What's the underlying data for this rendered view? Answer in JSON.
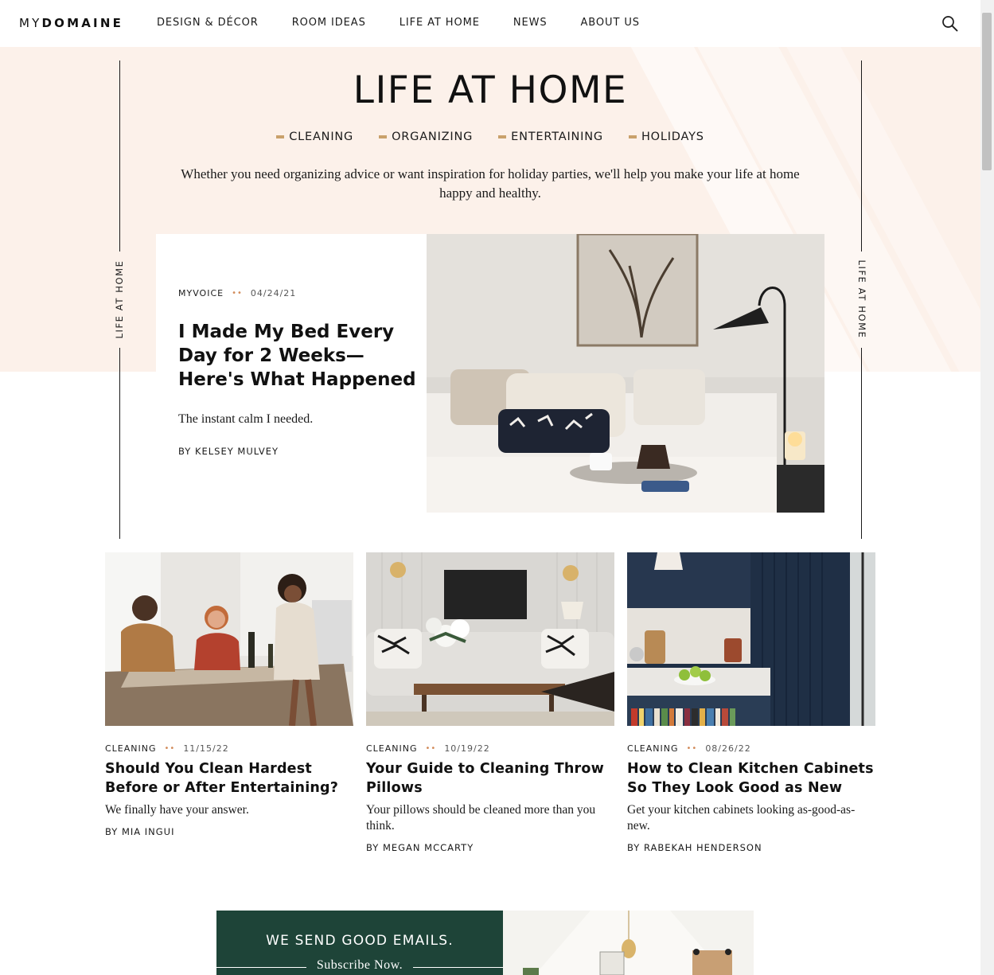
{
  "header": {
    "logo_my": "MY",
    "logo_domaine": "DOMAINE",
    "nav": [
      "DESIGN & DÉCOR",
      "ROOM IDEAS",
      "LIFE AT HOME",
      "NEWS",
      "ABOUT US"
    ]
  },
  "hero": {
    "title": "LIFE AT HOME",
    "side_label": "LIFE AT HOME",
    "subnav": [
      "CLEANING",
      "ORGANIZING",
      "ENTERTAINING",
      "HOLIDAYS"
    ],
    "intro": "Whether you need organizing advice or want inspiration for holiday parties, we'll help you make your life at home happy and healthy."
  },
  "featured": {
    "category": "MYVOICE",
    "dots": "••",
    "date": "04/24/21",
    "title": "I Made My Bed Every Day for 2 Weeks—Here's What Happened",
    "dek": "The instant calm I needed.",
    "byline": "BY KELSEY MULVEY"
  },
  "cards": [
    {
      "category": "CLEANING",
      "dots": "••",
      "date": "11/15/22",
      "title": "Should You Clean Hardest Before or After Entertaining?",
      "dek": "We finally have your answer.",
      "byline": "BY MIA INGUI"
    },
    {
      "category": "CLEANING",
      "dots": "••",
      "date": "10/19/22",
      "title": "Your Guide to Cleaning Throw Pillows",
      "dek": "Your pillows should be cleaned more than you think.",
      "byline": "BY MEGAN MCCARTY"
    },
    {
      "category": "CLEANING",
      "dots": "••",
      "date": "08/26/22",
      "title": "How to Clean Kitchen Cabinets So They Look Good as New",
      "dek": "Get your kitchen cabinets looking as-good-as-new.",
      "byline": "BY RABEKAH HENDERSON"
    }
  ],
  "newsletter": {
    "heading": "WE SEND GOOD EMAILS.",
    "cta": "Subscribe Now."
  },
  "colors": {
    "hero_bg": "#fcf1ea",
    "accent_dash": "#c9a16b",
    "meta_dots": "#d28b5a",
    "newsletter_bg": "#1e4438"
  },
  "icons": {
    "search": "search-icon"
  }
}
